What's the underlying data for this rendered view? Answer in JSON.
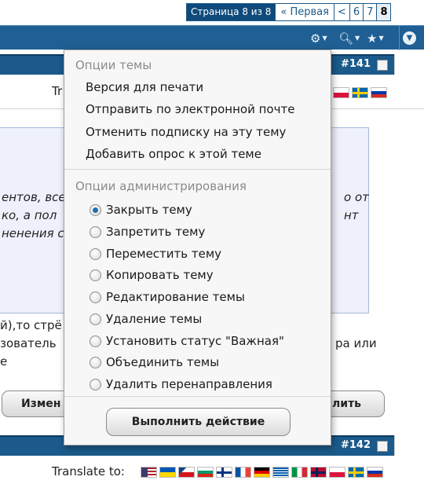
{
  "pagination": {
    "info": "Страница 8 из 8",
    "first": "« Первая",
    "prev": "<",
    "pages": [
      "6",
      "7"
    ],
    "current": "8"
  },
  "toolbar": {
    "icons": [
      "gear-icon",
      "search-icon",
      "star-icon",
      "menu-down-icon"
    ]
  },
  "post1": {
    "number": "#141",
    "translate_fragment": "Tr"
  },
  "post2": {
    "number": "#142",
    "translate_label": "Translate to:"
  },
  "quote_lines": {
    "l1": "ентов, все",
    "l1_right": "о от",
    "l2": "ко, а пол",
    "l2_right": "нт",
    "l3": "ненения со"
  },
  "body_lines": {
    "l1": "й),то стрё",
    "l2": "зователь",
    "l2_right": "ра или",
    "l3": "е"
  },
  "buttons": {
    "edit_fragment": "Измен",
    "delete_fragment": "лить"
  },
  "menu": {
    "thread_options_title": "Опции темы",
    "thread_options": [
      "Версия для печати",
      "Отправить по электронной почте",
      "Отменить подписку на эту тему",
      "Добавить опрос к этой теме"
    ],
    "admin_title": "Опции администрирования",
    "admin_options": [
      "Закрыть тему",
      "Запретить тему",
      "Переместить тему",
      "Копировать тему",
      "Редактирование темы",
      "Удаление темы",
      "Установить статус \"Важная\"",
      "Объединить темы",
      "Удалить перенаправления"
    ],
    "selected_admin_option": "Закрыть тему",
    "execute_button": "Выполнить действие"
  },
  "flags": [
    "us",
    "ua",
    "cz",
    "bg",
    "fi",
    "fr",
    "de",
    "gr",
    "it",
    "no",
    "pl",
    "se",
    "ru"
  ]
}
